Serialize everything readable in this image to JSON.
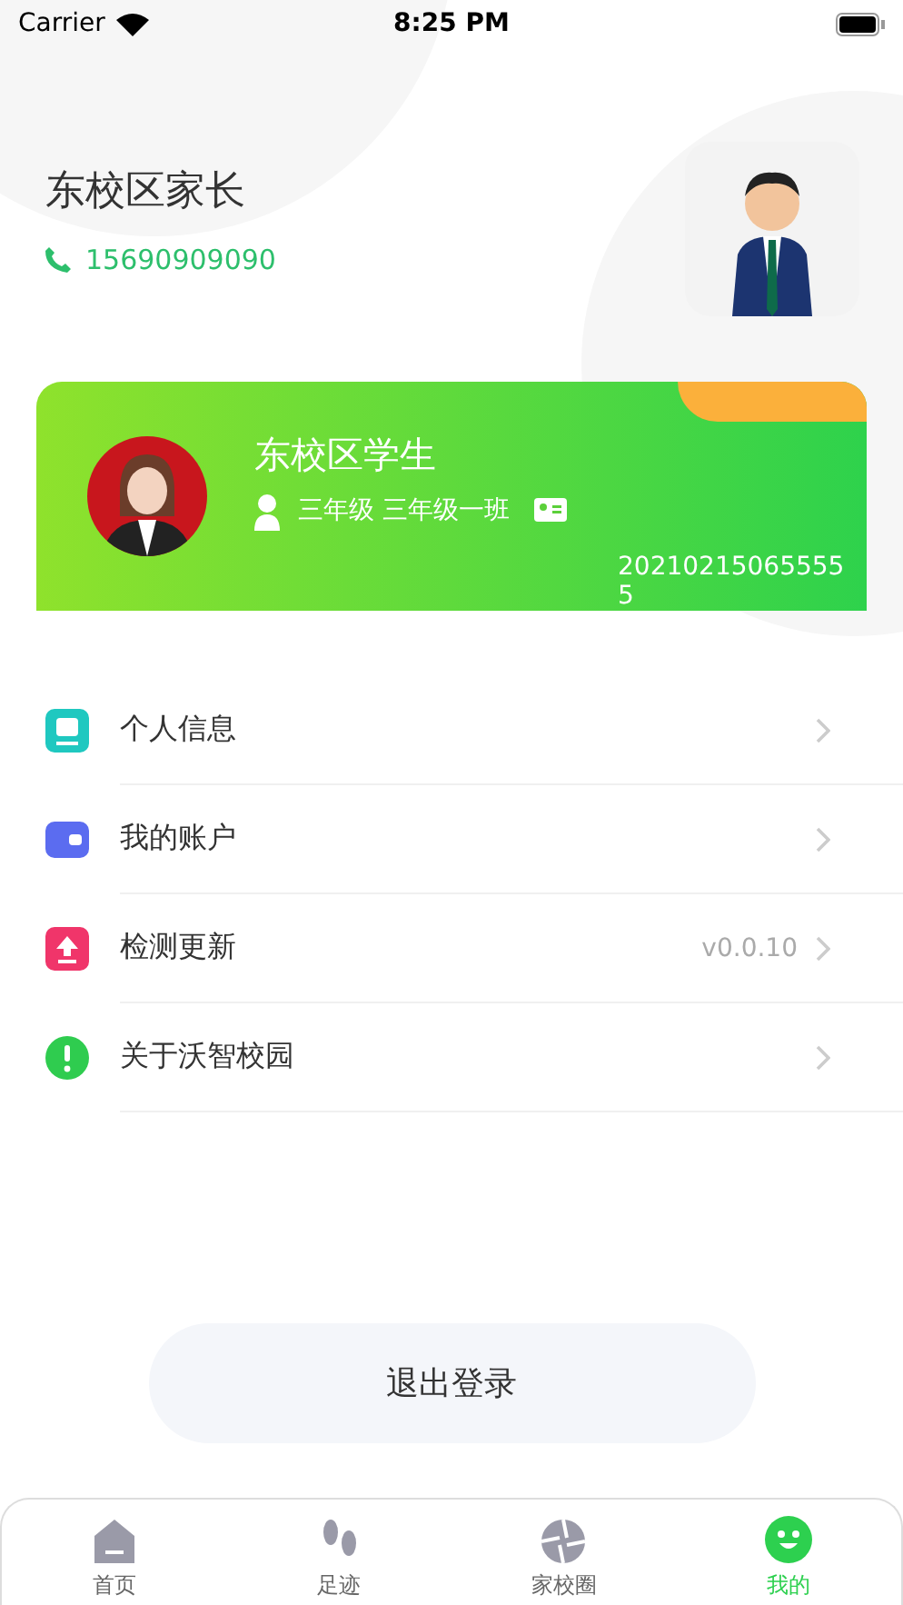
{
  "status_bar": {
    "carrier": "Carrier",
    "time": "8:25 PM"
  },
  "profile": {
    "name": "东校区家长",
    "phone": "15690909090"
  },
  "student_card": {
    "name": "东校区学生",
    "class": "三年级 三年级一班",
    "student_id": "20210215065555\n5"
  },
  "menu": [
    {
      "kind": "profile",
      "label": "个人信息",
      "color": "#1fc8c0"
    },
    {
      "kind": "wallet",
      "label": "我的账户",
      "color": "#5b6cf0"
    },
    {
      "kind": "update",
      "label": "检测更新",
      "value": "v0.0.10",
      "color": "#f0356a"
    },
    {
      "kind": "info",
      "label": "关于沃智校园",
      "color": "#2fcc4f"
    }
  ],
  "logout_button": "退出登录",
  "tab_bar": [
    {
      "kind": "home",
      "label": "首页",
      "selected": false
    },
    {
      "kind": "footprints",
      "label": "足迹",
      "selected": false
    },
    {
      "kind": "circle",
      "label": "家校圈",
      "selected": false
    },
    {
      "kind": "me",
      "label": "我的",
      "selected": true
    }
  ]
}
